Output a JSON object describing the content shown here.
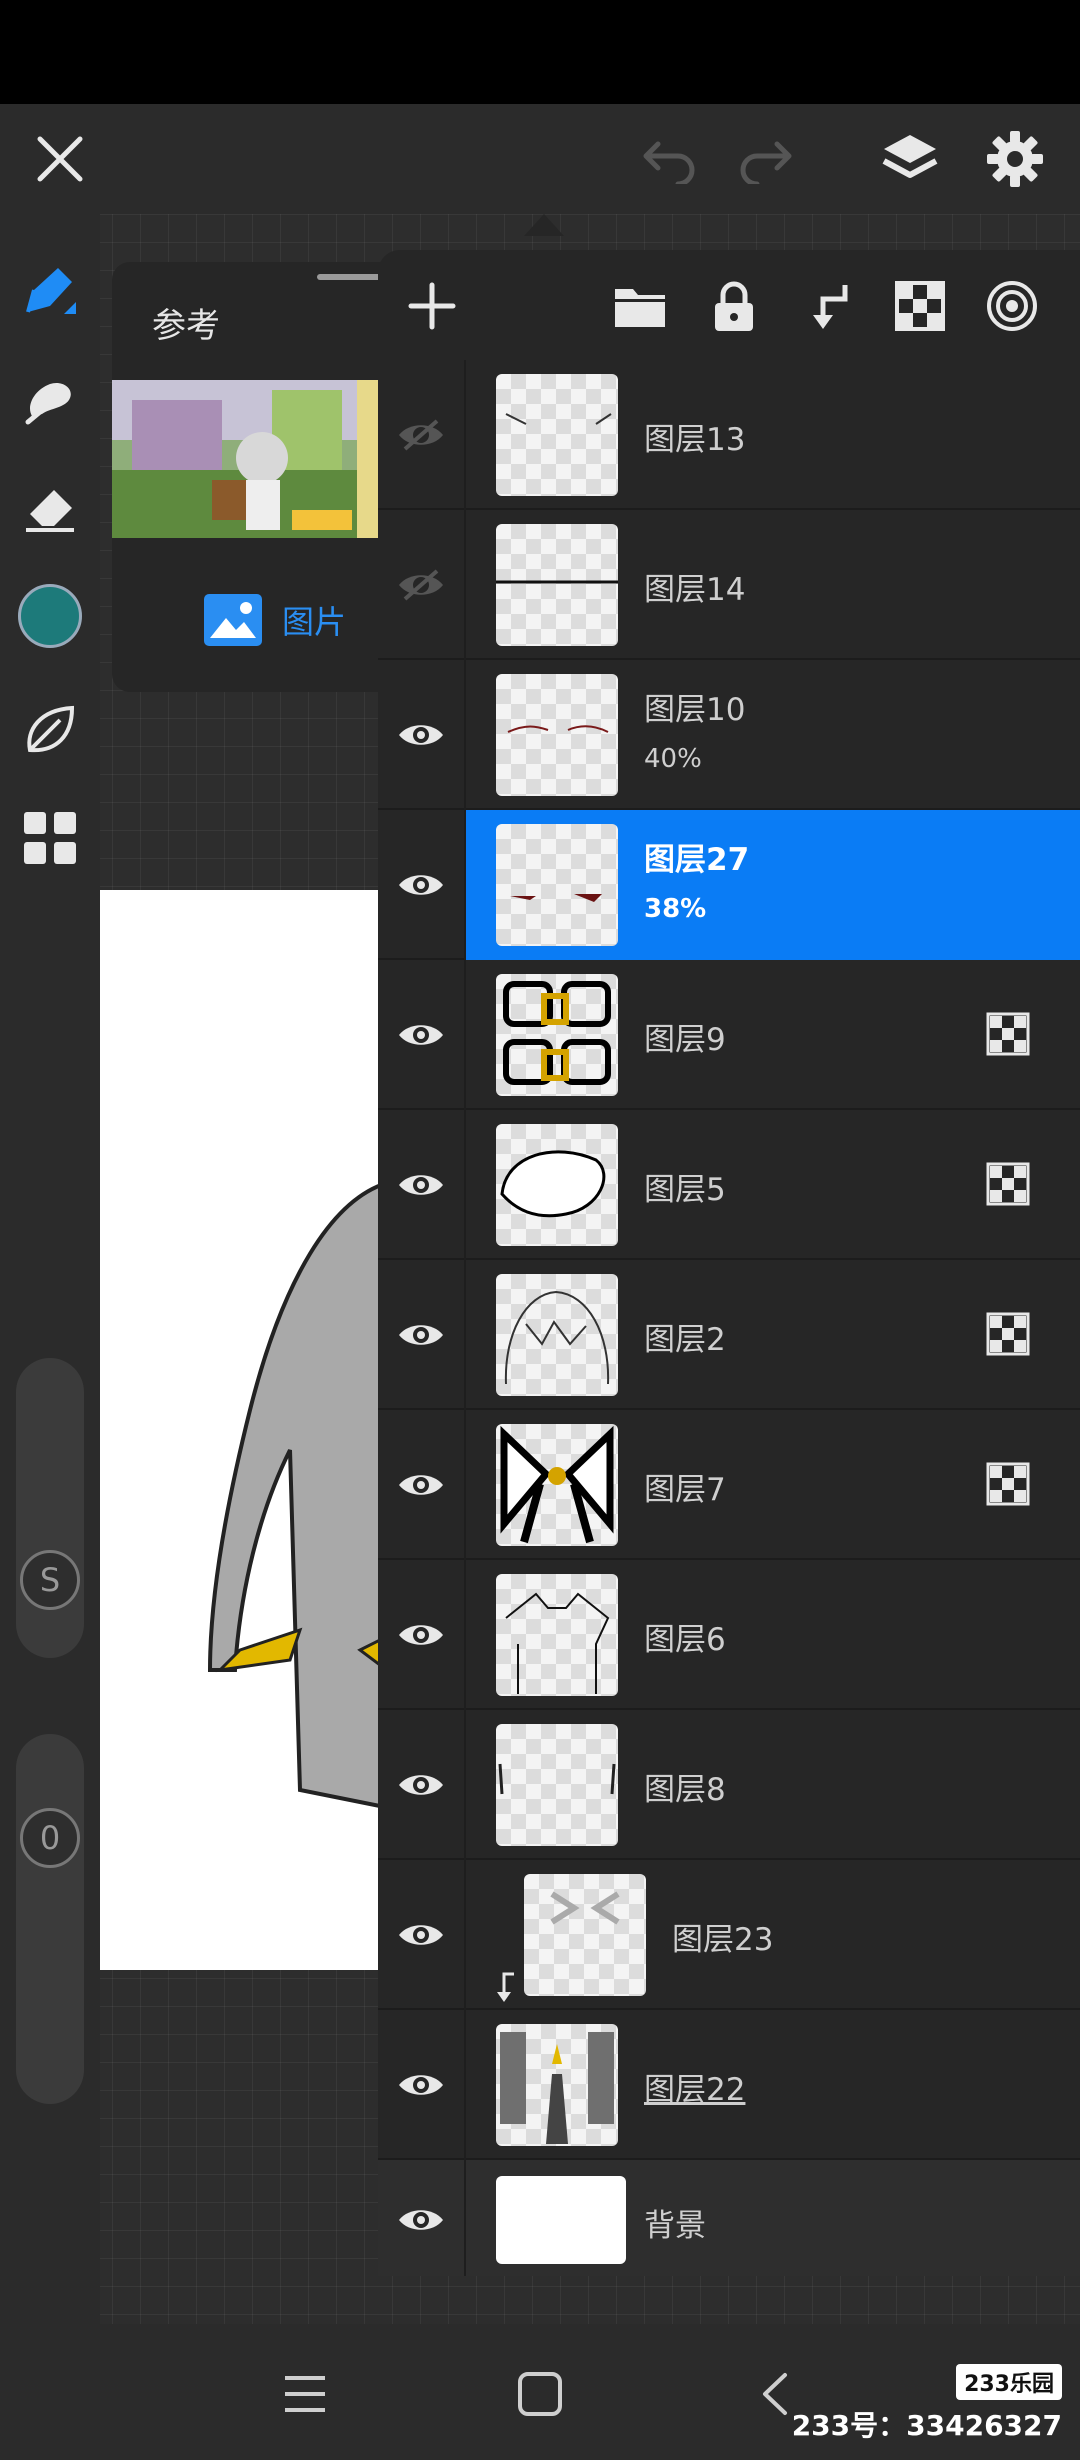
{
  "colors": {
    "accent": "#0a7cf5",
    "selected_color": "#1d7a7a",
    "panel_bg": "#262626"
  },
  "top_bar": {
    "icons": [
      "close-icon",
      "undo-icon",
      "redo-icon",
      "layers-icon",
      "settings-icon"
    ]
  },
  "left_toolbar": {
    "tools": [
      "pen-icon",
      "smudge-icon",
      "eraser-icon",
      "color-swatch",
      "leaf-icon",
      "grid-icon"
    ],
    "size_slider_label": "S",
    "opacity_slider_label": "0"
  },
  "reference": {
    "title": "参考",
    "image_label": "图片"
  },
  "layers_toolbar": {
    "icons": [
      "add-layer-icon",
      "folder-icon",
      "lock-icon",
      "merge-down-icon",
      "checker-icon",
      "target-icon"
    ]
  },
  "layers": [
    {
      "name": "图层13",
      "visible": false,
      "opacity": "",
      "alpha_lock": false,
      "selected": false
    },
    {
      "name": "图层14",
      "visible": false,
      "opacity": "",
      "alpha_lock": false,
      "selected": false
    },
    {
      "name": "图层10",
      "visible": true,
      "opacity": "40%",
      "alpha_lock": false,
      "selected": false
    },
    {
      "name": "图层27",
      "visible": true,
      "opacity": "38%",
      "alpha_lock": false,
      "selected": true
    },
    {
      "name": "图层9",
      "visible": true,
      "opacity": "",
      "alpha_lock": true,
      "selected": false
    },
    {
      "name": "图层5",
      "visible": true,
      "opacity": "",
      "alpha_lock": true,
      "selected": false
    },
    {
      "name": "图层2",
      "visible": true,
      "opacity": "",
      "alpha_lock": true,
      "selected": false
    },
    {
      "name": "图层7",
      "visible": true,
      "opacity": "",
      "alpha_lock": true,
      "selected": false
    },
    {
      "name": "图层6",
      "visible": true,
      "opacity": "",
      "alpha_lock": false,
      "selected": false
    },
    {
      "name": "图层8",
      "visible": true,
      "opacity": "",
      "alpha_lock": false,
      "selected": false
    },
    {
      "name": "图层23",
      "visible": true,
      "opacity": "",
      "alpha_lock": false,
      "selected": false,
      "clipped": true
    },
    {
      "name": "图层22",
      "visible": true,
      "opacity": "",
      "alpha_lock": false,
      "selected": false
    },
    {
      "name": "背景",
      "visible": true,
      "opacity": "",
      "alpha_lock": false,
      "selected": false
    }
  ],
  "nav_bar": {
    "icons": [
      "menu-icon",
      "home-icon",
      "back-icon"
    ]
  },
  "watermark": {
    "logo": "233乐园",
    "id": "233号：33426327"
  }
}
